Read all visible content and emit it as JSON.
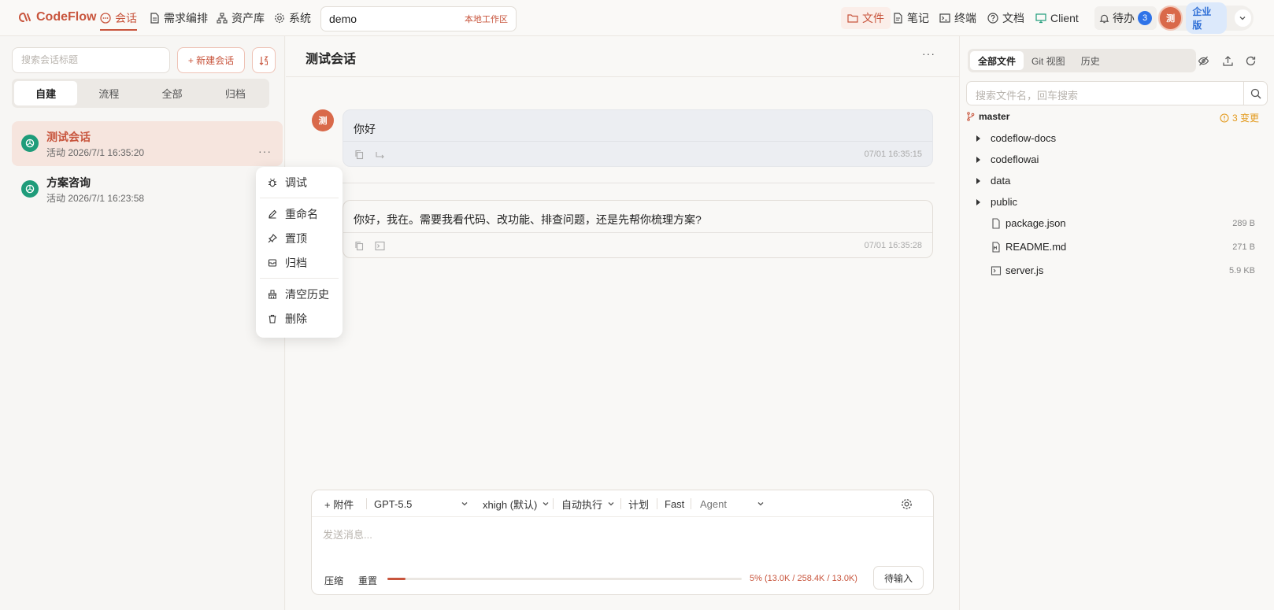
{
  "app": {
    "logo_text": "CodeFlow",
    "nav": [
      {
        "label": "会话",
        "icon": "chat-icon",
        "active": true
      },
      {
        "label": "需求编排",
        "icon": "doc-icon"
      },
      {
        "label": "资产库",
        "icon": "sitemap-icon"
      },
      {
        "label": "系统",
        "icon": "gear-icon"
      }
    ],
    "workspace": {
      "name": "demo",
      "tag": "本地工作区"
    },
    "top_right": {
      "files": "文件",
      "notes": "笔记",
      "terminal": "终端",
      "docs": "文档",
      "client": "Client",
      "todo": "待办",
      "todo_count": "3",
      "avatar": "测",
      "edition": "企业版"
    }
  },
  "sidebar": {
    "search_placeholder": "搜索会话标题",
    "new_button": "+ 新建会话",
    "segments": [
      "自建",
      "流程",
      "全部",
      "归档"
    ],
    "active_segment": 0,
    "conversations": [
      {
        "title": "测试会话",
        "time": "活动 2026/7/1 16:35:20",
        "active": true,
        "more": "···"
      },
      {
        "title": "方案咨询",
        "time": "活动 2026/7/1 16:23:58",
        "active": false
      }
    ]
  },
  "context_menu": {
    "items": [
      {
        "label": "调试",
        "icon": "bug-icon"
      },
      {
        "label": "重命名",
        "icon": "pencil-icon"
      },
      {
        "label": "置顶",
        "icon": "pin-icon"
      },
      {
        "label": "归档",
        "icon": "archive-icon"
      },
      {
        "label": "清空历史",
        "icon": "broom-icon"
      },
      {
        "label": "删除",
        "icon": "trash-icon"
      }
    ]
  },
  "chat": {
    "title": "测试会话",
    "more": "···",
    "messages": [
      {
        "role": "user",
        "avatar": "测",
        "text": "你好",
        "time": "07/01 16:35:15"
      },
      {
        "role": "assistant",
        "text": "你好，我在。需要我看代码、改功能、排查问题，还是先帮你梳理方案?",
        "time": "07/01 16:35:28"
      }
    ],
    "composer": {
      "attach": "+ 附件",
      "model": "GPT-5.5",
      "reasoning": "xhigh (默认)",
      "exec_mode": "自动执行",
      "plan": "计划",
      "fast": "Fast",
      "agent": "Agent",
      "placeholder": "发送消息...",
      "compress": "压缩",
      "reset": "重置",
      "context_percent": 5,
      "context_readout": "5% (13.0K / 258.4K / 13.0K)",
      "send_label": "待输入"
    }
  },
  "files": {
    "tabs": [
      "全部文件",
      "Git 视图",
      "历史"
    ],
    "active_tab": 0,
    "search_placeholder": "搜索文件名，回车搜索",
    "branch": "master",
    "changes": "3 变更",
    "folders": [
      "codeflow-docs",
      "codeflowai",
      "data",
      "public"
    ],
    "file_list": [
      {
        "name": "package.json",
        "size": "289 B",
        "icon": "file-icon"
      },
      {
        "name": "README.md",
        "size": "271 B",
        "icon": "markdown-file-icon"
      },
      {
        "name": "server.js",
        "size": "5.9 KB",
        "icon": "terminal-file-icon"
      }
    ]
  },
  "colors": {
    "accent": "#c8553d",
    "badge_blue": "#2f73e8",
    "openai_green": "#1f9c7a"
  }
}
